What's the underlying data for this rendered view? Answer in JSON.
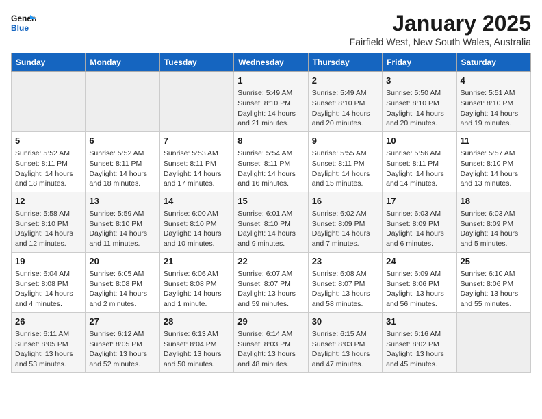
{
  "logo": {
    "line1": "General",
    "line2": "Blue"
  },
  "title": "January 2025",
  "location": "Fairfield West, New South Wales, Australia",
  "days_of_week": [
    "Sunday",
    "Monday",
    "Tuesday",
    "Wednesday",
    "Thursday",
    "Friday",
    "Saturday"
  ],
  "weeks": [
    [
      {
        "day": "",
        "sunrise": "",
        "sunset": "",
        "daylight": ""
      },
      {
        "day": "",
        "sunrise": "",
        "sunset": "",
        "daylight": ""
      },
      {
        "day": "",
        "sunrise": "",
        "sunset": "",
        "daylight": ""
      },
      {
        "day": "1",
        "sunrise": "Sunrise: 5:49 AM",
        "sunset": "Sunset: 8:10 PM",
        "daylight": "Daylight: 14 hours and 21 minutes."
      },
      {
        "day": "2",
        "sunrise": "Sunrise: 5:49 AM",
        "sunset": "Sunset: 8:10 PM",
        "daylight": "Daylight: 14 hours and 20 minutes."
      },
      {
        "day": "3",
        "sunrise": "Sunrise: 5:50 AM",
        "sunset": "Sunset: 8:10 PM",
        "daylight": "Daylight: 14 hours and 20 minutes."
      },
      {
        "day": "4",
        "sunrise": "Sunrise: 5:51 AM",
        "sunset": "Sunset: 8:10 PM",
        "daylight": "Daylight: 14 hours and 19 minutes."
      }
    ],
    [
      {
        "day": "5",
        "sunrise": "Sunrise: 5:52 AM",
        "sunset": "Sunset: 8:11 PM",
        "daylight": "Daylight: 14 hours and 18 minutes."
      },
      {
        "day": "6",
        "sunrise": "Sunrise: 5:52 AM",
        "sunset": "Sunset: 8:11 PM",
        "daylight": "Daylight: 14 hours and 18 minutes."
      },
      {
        "day": "7",
        "sunrise": "Sunrise: 5:53 AM",
        "sunset": "Sunset: 8:11 PM",
        "daylight": "Daylight: 14 hours and 17 minutes."
      },
      {
        "day": "8",
        "sunrise": "Sunrise: 5:54 AM",
        "sunset": "Sunset: 8:11 PM",
        "daylight": "Daylight: 14 hours and 16 minutes."
      },
      {
        "day": "9",
        "sunrise": "Sunrise: 5:55 AM",
        "sunset": "Sunset: 8:11 PM",
        "daylight": "Daylight: 14 hours and 15 minutes."
      },
      {
        "day": "10",
        "sunrise": "Sunrise: 5:56 AM",
        "sunset": "Sunset: 8:11 PM",
        "daylight": "Daylight: 14 hours and 14 minutes."
      },
      {
        "day": "11",
        "sunrise": "Sunrise: 5:57 AM",
        "sunset": "Sunset: 8:10 PM",
        "daylight": "Daylight: 14 hours and 13 minutes."
      }
    ],
    [
      {
        "day": "12",
        "sunrise": "Sunrise: 5:58 AM",
        "sunset": "Sunset: 8:10 PM",
        "daylight": "Daylight: 14 hours and 12 minutes."
      },
      {
        "day": "13",
        "sunrise": "Sunrise: 5:59 AM",
        "sunset": "Sunset: 8:10 PM",
        "daylight": "Daylight: 14 hours and 11 minutes."
      },
      {
        "day": "14",
        "sunrise": "Sunrise: 6:00 AM",
        "sunset": "Sunset: 8:10 PM",
        "daylight": "Daylight: 14 hours and 10 minutes."
      },
      {
        "day": "15",
        "sunrise": "Sunrise: 6:01 AM",
        "sunset": "Sunset: 8:10 PM",
        "daylight": "Daylight: 14 hours and 9 minutes."
      },
      {
        "day": "16",
        "sunrise": "Sunrise: 6:02 AM",
        "sunset": "Sunset: 8:09 PM",
        "daylight": "Daylight: 14 hours and 7 minutes."
      },
      {
        "day": "17",
        "sunrise": "Sunrise: 6:03 AM",
        "sunset": "Sunset: 8:09 PM",
        "daylight": "Daylight: 14 hours and 6 minutes."
      },
      {
        "day": "18",
        "sunrise": "Sunrise: 6:03 AM",
        "sunset": "Sunset: 8:09 PM",
        "daylight": "Daylight: 14 hours and 5 minutes."
      }
    ],
    [
      {
        "day": "19",
        "sunrise": "Sunrise: 6:04 AM",
        "sunset": "Sunset: 8:08 PM",
        "daylight": "Daylight: 14 hours and 4 minutes."
      },
      {
        "day": "20",
        "sunrise": "Sunrise: 6:05 AM",
        "sunset": "Sunset: 8:08 PM",
        "daylight": "Daylight: 14 hours and 2 minutes."
      },
      {
        "day": "21",
        "sunrise": "Sunrise: 6:06 AM",
        "sunset": "Sunset: 8:08 PM",
        "daylight": "Daylight: 14 hours and 1 minute."
      },
      {
        "day": "22",
        "sunrise": "Sunrise: 6:07 AM",
        "sunset": "Sunset: 8:07 PM",
        "daylight": "Daylight: 13 hours and 59 minutes."
      },
      {
        "day": "23",
        "sunrise": "Sunrise: 6:08 AM",
        "sunset": "Sunset: 8:07 PM",
        "daylight": "Daylight: 13 hours and 58 minutes."
      },
      {
        "day": "24",
        "sunrise": "Sunrise: 6:09 AM",
        "sunset": "Sunset: 8:06 PM",
        "daylight": "Daylight: 13 hours and 56 minutes."
      },
      {
        "day": "25",
        "sunrise": "Sunrise: 6:10 AM",
        "sunset": "Sunset: 8:06 PM",
        "daylight": "Daylight: 13 hours and 55 minutes."
      }
    ],
    [
      {
        "day": "26",
        "sunrise": "Sunrise: 6:11 AM",
        "sunset": "Sunset: 8:05 PM",
        "daylight": "Daylight: 13 hours and 53 minutes."
      },
      {
        "day": "27",
        "sunrise": "Sunrise: 6:12 AM",
        "sunset": "Sunset: 8:05 PM",
        "daylight": "Daylight: 13 hours and 52 minutes."
      },
      {
        "day": "28",
        "sunrise": "Sunrise: 6:13 AM",
        "sunset": "Sunset: 8:04 PM",
        "daylight": "Daylight: 13 hours and 50 minutes."
      },
      {
        "day": "29",
        "sunrise": "Sunrise: 6:14 AM",
        "sunset": "Sunset: 8:03 PM",
        "daylight": "Daylight: 13 hours and 48 minutes."
      },
      {
        "day": "30",
        "sunrise": "Sunrise: 6:15 AM",
        "sunset": "Sunset: 8:03 PM",
        "daylight": "Daylight: 13 hours and 47 minutes."
      },
      {
        "day": "31",
        "sunrise": "Sunrise: 6:16 AM",
        "sunset": "Sunset: 8:02 PM",
        "daylight": "Daylight: 13 hours and 45 minutes."
      },
      {
        "day": "",
        "sunrise": "",
        "sunset": "",
        "daylight": ""
      }
    ]
  ]
}
